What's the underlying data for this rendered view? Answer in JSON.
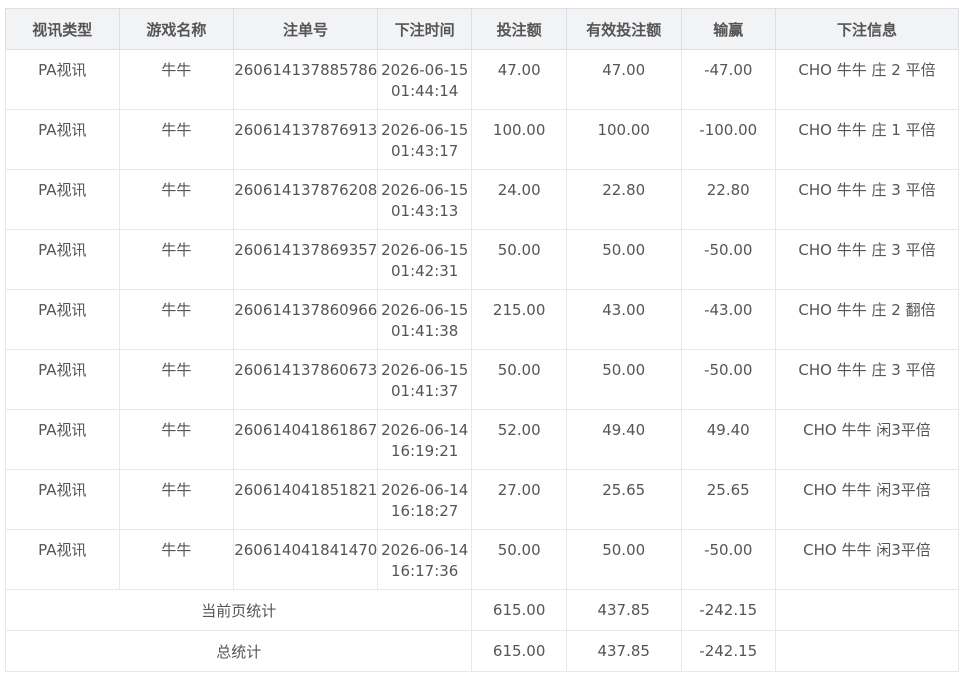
{
  "headers": [
    "视讯类型",
    "游戏名称",
    "注单号",
    "下注时间",
    "投注额",
    "有效投注额",
    "输赢",
    "下注信息"
  ],
  "rows": [
    {
      "type": "PA视讯",
      "game": "牛牛",
      "order": "260614137885786",
      "date": "2026-06-15",
      "time": "01:44:14",
      "bet": "47.00",
      "valid": "47.00",
      "win": "-47.00",
      "info": "CHO 牛牛 庄 2 平倍"
    },
    {
      "type": "PA视讯",
      "game": "牛牛",
      "order": "260614137876913",
      "date": "2026-06-15",
      "time": "01:43:17",
      "bet": "100.00",
      "valid": "100.00",
      "win": "-100.00",
      "info": "CHO 牛牛 庄 1 平倍"
    },
    {
      "type": "PA视讯",
      "game": "牛牛",
      "order": "260614137876208",
      "date": "2026-06-15",
      "time": "01:43:13",
      "bet": "24.00",
      "valid": "22.80",
      "win": "22.80",
      "info": "CHO 牛牛 庄 3 平倍"
    },
    {
      "type": "PA视讯",
      "game": "牛牛",
      "order": "260614137869357",
      "date": "2026-06-15",
      "time": "01:42:31",
      "bet": "50.00",
      "valid": "50.00",
      "win": "-50.00",
      "info": "CHO 牛牛 庄 3 平倍"
    },
    {
      "type": "PA视讯",
      "game": "牛牛",
      "order": "260614137860966",
      "date": "2026-06-15",
      "time": "01:41:38",
      "bet": "215.00",
      "valid": "43.00",
      "win": "-43.00",
      "info": "CHO 牛牛 庄 2 翻倍"
    },
    {
      "type": "PA视讯",
      "game": "牛牛",
      "order": "260614137860673",
      "date": "2026-06-15",
      "time": "01:41:37",
      "bet": "50.00",
      "valid": "50.00",
      "win": "-50.00",
      "info": "CHO 牛牛 庄 3 平倍"
    },
    {
      "type": "PA视讯",
      "game": "牛牛",
      "order": "260614041861867",
      "date": "2026-06-14",
      "time": "16:19:21",
      "bet": "52.00",
      "valid": "49.40",
      "win": "49.40",
      "info": "CHO 牛牛 闲3平倍"
    },
    {
      "type": "PA视讯",
      "game": "牛牛",
      "order": "260614041851821",
      "date": "2026-06-14",
      "time": "16:18:27",
      "bet": "27.00",
      "valid": "25.65",
      "win": "25.65",
      "info": "CHO 牛牛 闲3平倍"
    },
    {
      "type": "PA视讯",
      "game": "牛牛",
      "order": "260614041841470",
      "date": "2026-06-14",
      "time": "16:17:36",
      "bet": "50.00",
      "valid": "50.00",
      "win": "-50.00",
      "info": "CHO 牛牛 闲3平倍"
    }
  ],
  "footer": [
    {
      "label": "当前页统计",
      "bet": "615.00",
      "valid": "437.85",
      "win": "-242.15"
    },
    {
      "label": "总统计",
      "bet": "615.00",
      "valid": "437.85",
      "win": "-242.15"
    }
  ]
}
